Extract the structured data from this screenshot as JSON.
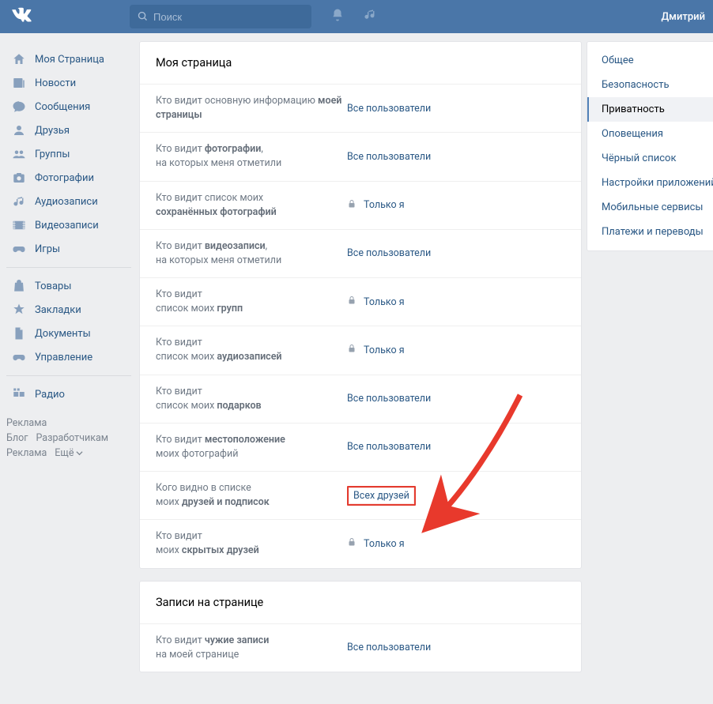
{
  "topbar": {
    "search_placeholder": "Поиск",
    "username": "Дмитрий"
  },
  "leftnav": {
    "items1": [
      {
        "icon": "home",
        "label": "Моя Страница"
      },
      {
        "icon": "news",
        "label": "Новости"
      },
      {
        "icon": "msg",
        "label": "Сообщения"
      },
      {
        "icon": "friends",
        "label": "Друзья"
      },
      {
        "icon": "groups",
        "label": "Группы"
      },
      {
        "icon": "photo",
        "label": "Фотографии"
      },
      {
        "icon": "audio",
        "label": "Аудиозаписи"
      },
      {
        "icon": "video",
        "label": "Видеозаписи"
      },
      {
        "icon": "games",
        "label": "Игры"
      }
    ],
    "items2": [
      {
        "icon": "market",
        "label": "Товары"
      },
      {
        "icon": "bookmark",
        "label": "Закладки"
      },
      {
        "icon": "docs",
        "label": "Документы"
      },
      {
        "icon": "manage",
        "label": "Управление"
      }
    ],
    "items3": [
      {
        "icon": "radio",
        "label": "Радио"
      }
    ],
    "footer": {
      "ad": "Реклама",
      "blog": "Блог",
      "dev": "Разработчикам",
      "ad2": "Реклама",
      "more": "Ещё"
    }
  },
  "rightnav": {
    "items": [
      {
        "label": "Общее"
      },
      {
        "label": "Безопасность"
      },
      {
        "label": "Приватность",
        "active": true
      },
      {
        "label": "Оповещения"
      },
      {
        "label": "Чёрный список"
      },
      {
        "label": "Настройки приложений"
      },
      {
        "label": "Мобильные сервисы"
      },
      {
        "label": "Платежи и переводы"
      }
    ]
  },
  "main": {
    "section1_title": "Моя страница",
    "settings": [
      {
        "label_pre": "Кто видит основную информацию ",
        "label_bold": "моей страницы",
        "label_post": "",
        "value": "Все пользователи",
        "locked": false
      },
      {
        "label_pre": "Кто видит ",
        "label_bold": "фотографии",
        "label_post": ",\nна которых меня отметили",
        "value": "Все пользователи",
        "locked": false
      },
      {
        "label_pre": "Кто видит список моих\n",
        "label_bold": "сохранённых фотографий",
        "label_post": "",
        "value": "Только я",
        "locked": true
      },
      {
        "label_pre": "Кто видит ",
        "label_bold": "видеозаписи",
        "label_post": ",\nна которых меня отметили",
        "value": "Все пользователи",
        "locked": false
      },
      {
        "label_pre": "Кто видит\nсписок моих ",
        "label_bold": "групп",
        "label_post": "",
        "value": "Только я",
        "locked": true
      },
      {
        "label_pre": "Кто видит\nсписок моих ",
        "label_bold": "аудиозаписей",
        "label_post": "",
        "value": "Только я",
        "locked": true
      },
      {
        "label_pre": "Кто видит\nсписок моих ",
        "label_bold": "подарков",
        "label_post": "",
        "value": "Все пользователи",
        "locked": false
      },
      {
        "label_pre": "Кто видит ",
        "label_bold": "местоположение",
        "label_post": "\nмоих фотографий",
        "value": "Все пользователи",
        "locked": false
      },
      {
        "label_pre": "Кого видно в списке\nмоих ",
        "label_bold": "друзей и подписок",
        "label_post": "",
        "value": "Всех друзей",
        "locked": false,
        "highlight": true
      },
      {
        "label_pre": "Кто видит\nмоих ",
        "label_bold": "скрытых друзей",
        "label_post": "",
        "value": "Только я",
        "locked": true
      }
    ],
    "section2_title": "Записи на странице",
    "settings2": [
      {
        "label_pre": "Кто видит ",
        "label_bold": "чужие записи",
        "label_post": "\nна моей странице",
        "value": "Все пользователи",
        "locked": false
      }
    ]
  }
}
